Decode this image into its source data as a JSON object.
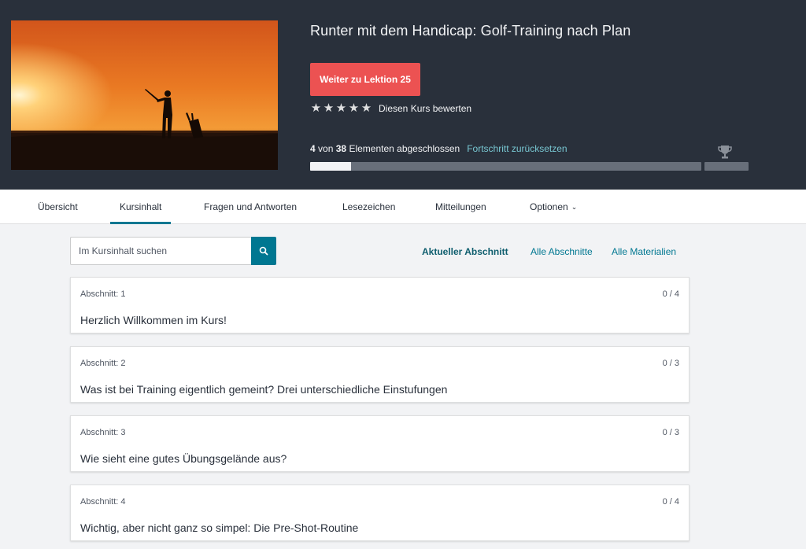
{
  "course": {
    "title": "Runter mit dem Handicap: Golf-Training nach Plan",
    "continue_label": "Weiter zu Lektion 25",
    "rating_label": "Diesen Kurs bewerten",
    "stars": 5,
    "progress": {
      "completed": "4",
      "of_word": "von",
      "total": "38",
      "suffix": "Elementen abgeschlossen",
      "reset_label": "Fortschritt zurücksetzen",
      "fraction": 0.105
    }
  },
  "nav": {
    "tabs": [
      {
        "label": "Übersicht"
      },
      {
        "label": "Kursinhalt"
      },
      {
        "label": "Fragen und Antworten"
      },
      {
        "label": "Lesezeichen"
      },
      {
        "label": "Mitteilungen"
      },
      {
        "label": "Optionen"
      }
    ],
    "active": "Kursinhalt"
  },
  "search": {
    "placeholder": "Im Kursinhalt suchen"
  },
  "filters": {
    "current": "Aktueller Abschnitt",
    "all_sections": "Alle Abschnitte",
    "all_materials": "Alle Materialien"
  },
  "sections": [
    {
      "label": "Abschnitt: 1",
      "count": "0 / 4",
      "title": "Herzlich Willkommen im Kurs!"
    },
    {
      "label": "Abschnitt: 2",
      "count": "0 / 3",
      "title": "Was ist bei Training eigentlich gemeint? Drei unterschiedliche Einstufungen"
    },
    {
      "label": "Abschnitt: 3",
      "count": "0 / 3",
      "title": "Wie sieht eine gutes Übungsgelände aus?"
    },
    {
      "label": "Abschnitt: 4",
      "count": "0 / 4",
      "title": "Wichtig, aber nicht ganz so simpel: Die Pre-Shot-Routine"
    }
  ],
  "colors": {
    "header_bg": "#29303b",
    "accent_red": "#ec5252",
    "link_teal": "#007791",
    "page_bg": "#f2f3f5"
  }
}
